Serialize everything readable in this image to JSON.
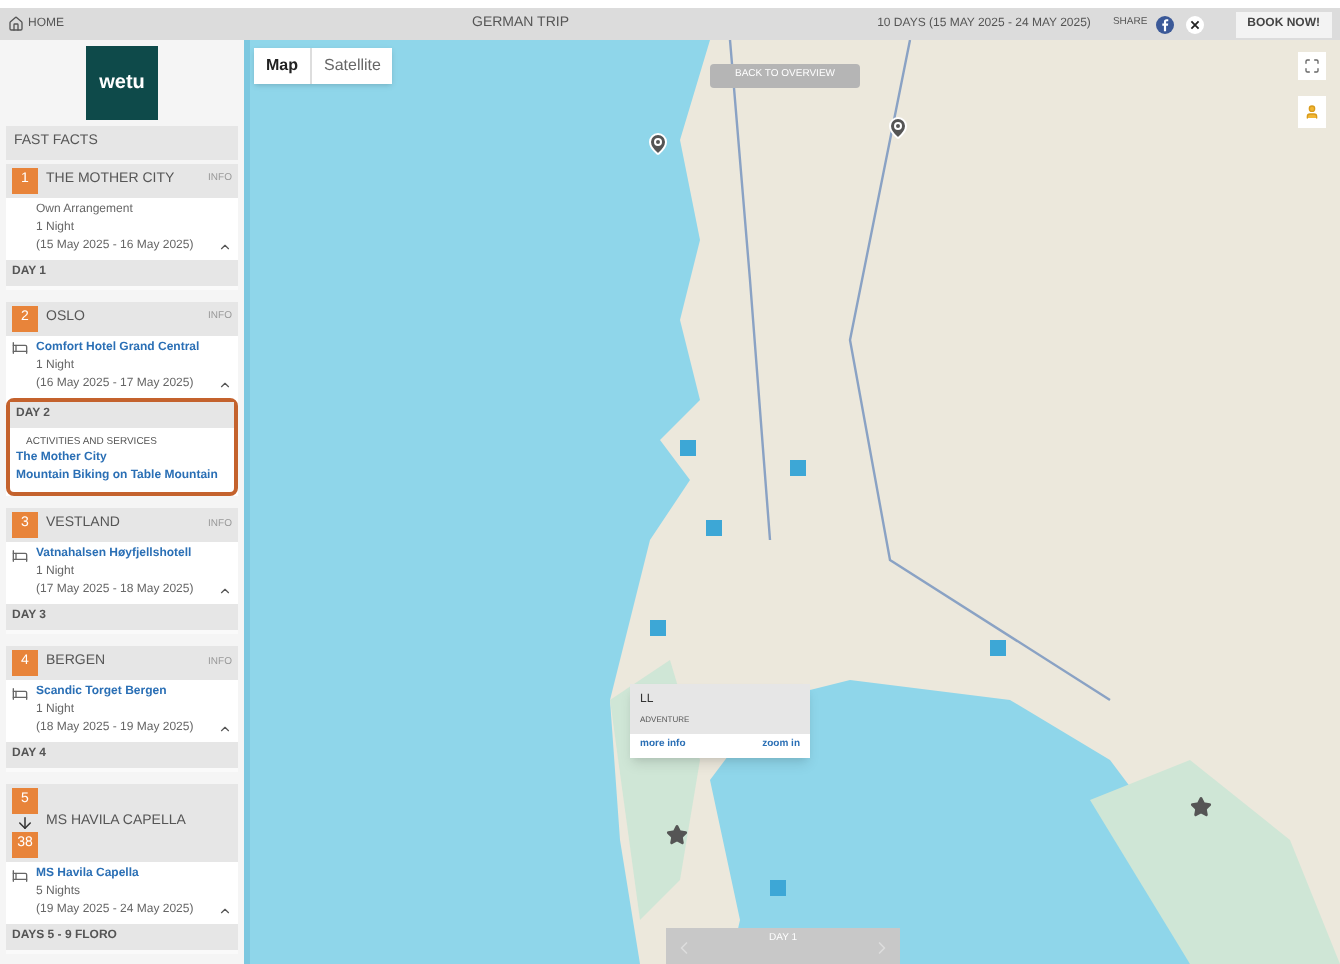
{
  "header": {
    "home": "HOME",
    "title": "GERMAN TRIP",
    "dates": "10 DAYS (15 MAY 2025 - 24 MAY 2025)",
    "share": "SHARE",
    "book": "BOOK NOW!"
  },
  "sidebar": {
    "logo": "wetu",
    "fast_facts": "FAST FACTS",
    "stops": [
      {
        "numbers": [
          "1"
        ],
        "name": "THE MOTHER CITY",
        "info": "INFO",
        "lines": [
          "Own Arrangement",
          "1 Night",
          "(15 May 2025 - 16 May 2025)"
        ],
        "day": {
          "label": "DAY 1",
          "highlighted": false
        }
      },
      {
        "numbers": [
          "2"
        ],
        "name": "OSLO",
        "info": "INFO",
        "hotel": "Comfort Hotel Grand Central",
        "lines": [
          "1 Night",
          "(16 May 2025 - 17 May 2025)"
        ],
        "day": {
          "label": "DAY 2",
          "highlighted": true,
          "activities_title": "ACTIVITIES AND SERVICES",
          "activities": [
            "The Mother City",
            "Mountain Biking on Table Mountain"
          ]
        }
      },
      {
        "numbers": [
          "3"
        ],
        "name": "VESTLAND",
        "info": "INFO",
        "hotel": "Vatnahalsen Høyfjellshotell",
        "lines": [
          "1 Night",
          "(17 May 2025 - 18 May 2025)"
        ],
        "day": {
          "label": "DAY 3",
          "highlighted": false
        }
      },
      {
        "numbers": [
          "4"
        ],
        "name": "BERGEN",
        "info": "INFO",
        "hotel": "Scandic Torget Bergen",
        "lines": [
          "1 Night",
          "(18 May 2025 - 19 May 2025)"
        ],
        "day": {
          "label": "DAY 4",
          "highlighted": false
        }
      },
      {
        "numbers": [
          "5",
          "38"
        ],
        "name": "MS HAVILA CAPELLA",
        "hotel": "MS Havila Capella",
        "lines": [
          "5 Nights",
          "(19 May 2025 - 24 May 2025)"
        ],
        "day": {
          "label": "DAYS 5 - 9 FLORO",
          "highlighted": false
        }
      }
    ]
  },
  "map": {
    "tabs": [
      {
        "label": "Map",
        "selected": true
      },
      {
        "label": "Satellite",
        "selected": false
      }
    ],
    "back": "BACK TO OVERVIEW",
    "popup": {
      "title": "LL",
      "subtitle": "ADVENTURE",
      "links": [
        "more info",
        "zoom in"
      ]
    },
    "day_bar": "DAY 1"
  }
}
